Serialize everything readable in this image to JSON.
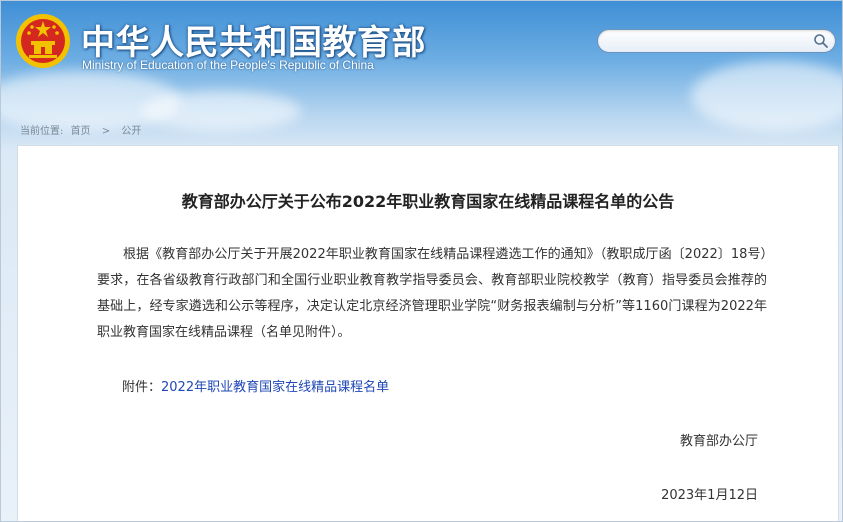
{
  "header": {
    "title": "中华人民共和国教育部",
    "subtitle": "Ministry of Education of the People's Republic of China",
    "emblem_icon": "national-emblem-icon"
  },
  "search": {
    "value": "",
    "placeholder": "",
    "icon": "search-icon"
  },
  "breadcrumb": {
    "label": "当前位置:",
    "items": [
      "首页",
      "公开"
    ],
    "separator": ">"
  },
  "article": {
    "title": "教育部办公厅关于公布2022年职业教育国家在线精品课程名单的公告",
    "body": "根据《教育部办公厅关于开展2022年职业教育国家在线精品课程遴选工作的通知》（教职成厅函〔2022〕18号）要求，在各省级教育行政部门和全国行业职业教育教学指导委员会、教育部职业院校教学（教育）指导委员会推荐的基础上，经专家遴选和公示等程序，决定认定北京经济管理职业学院“财务报表编制与分析”等1160门课程为2022年职业教育国家在线精品课程（名单见附件）。",
    "attachment_label": "附件：",
    "attachment_link": "2022年职业教育国家在线精品课程名单",
    "signature": "教育部办公厅",
    "date": "2023年1月12日"
  },
  "colors": {
    "header_blue": "#3f8fd6",
    "link": "#1f47b7",
    "emblem_red": "#d4271f",
    "emblem_gold": "#f2c200"
  }
}
